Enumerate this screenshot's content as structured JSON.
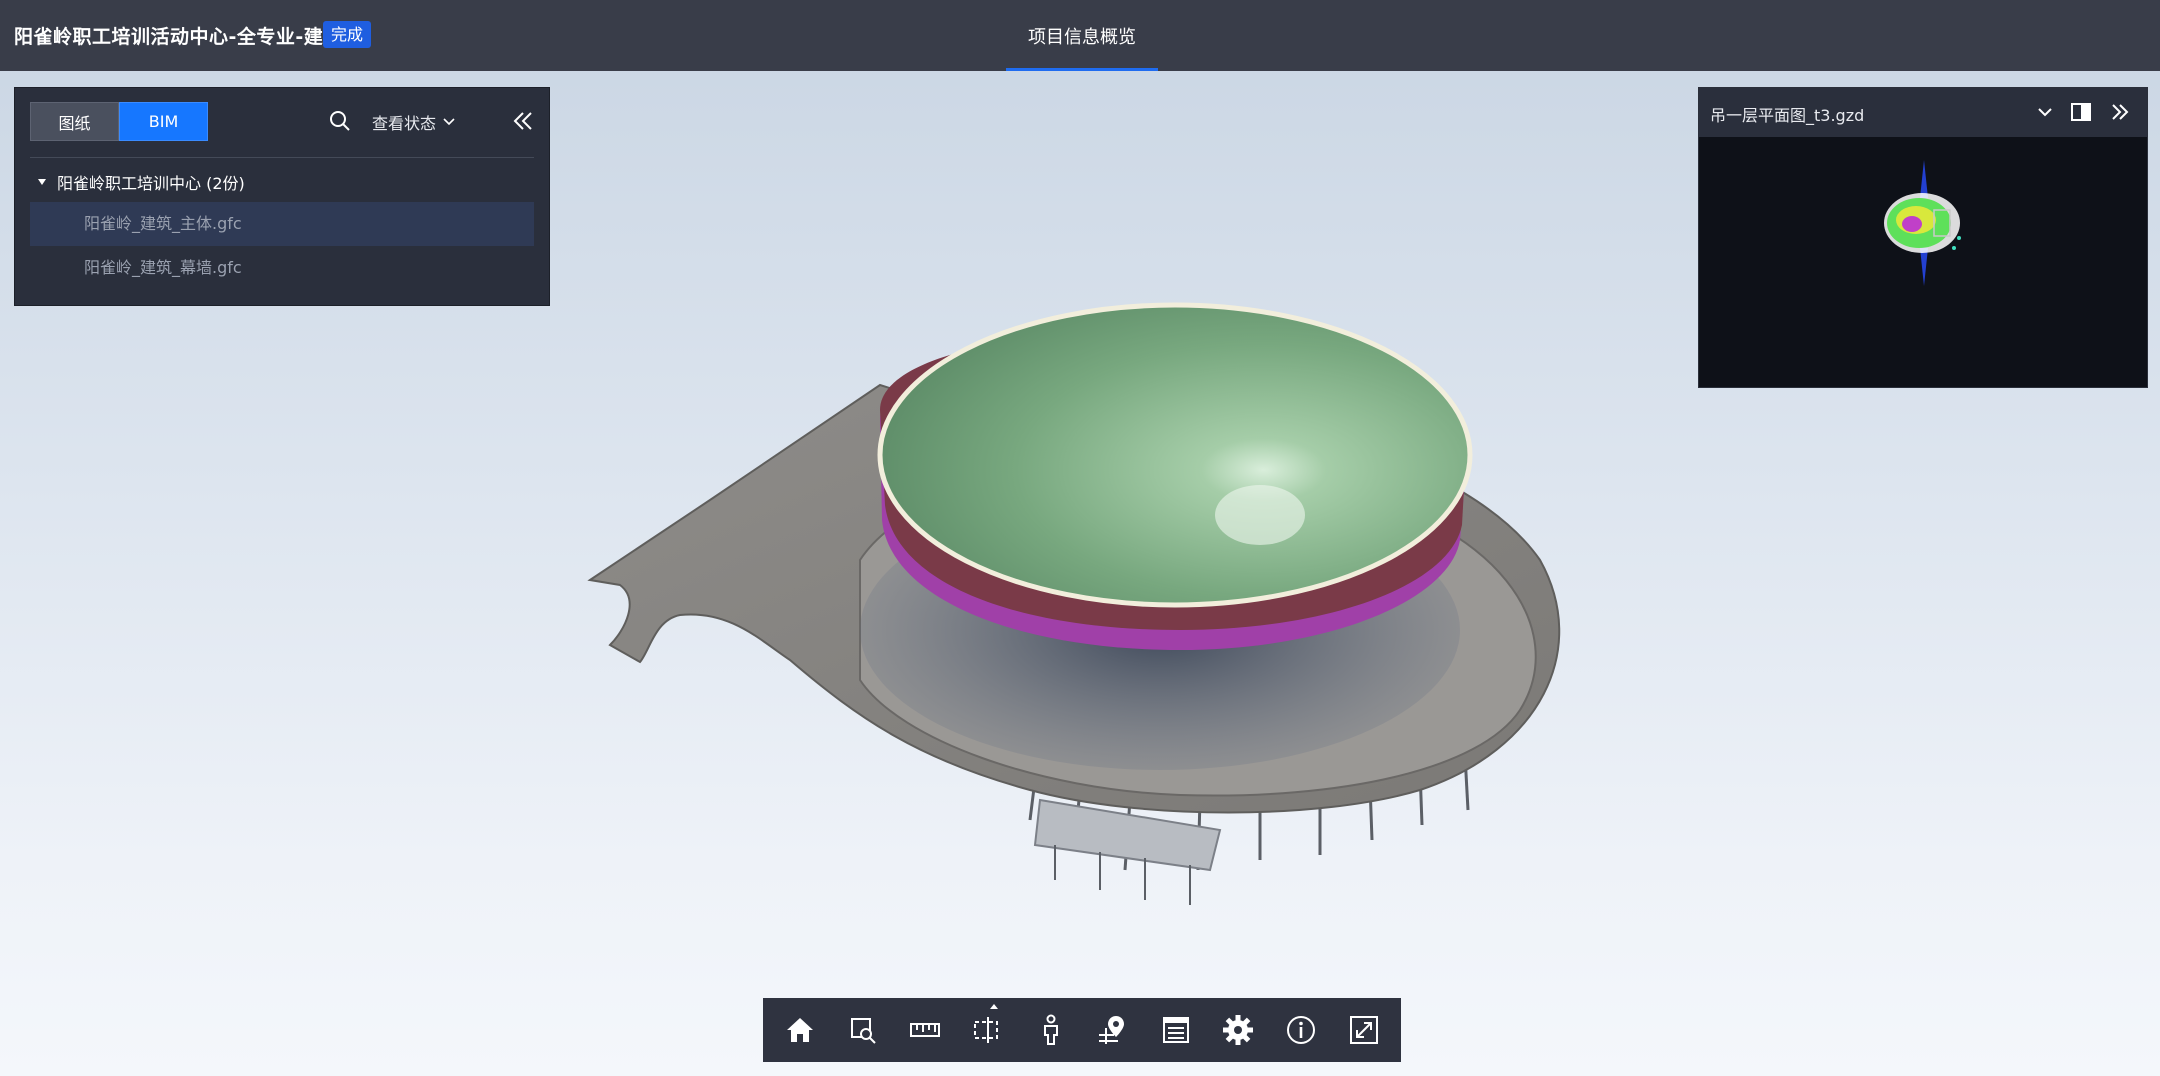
{
  "header": {
    "project_title": "阳雀岭职工培训活动中心-全专业-建筑",
    "status_badge": "完成",
    "center_tab": "项目信息概览"
  },
  "left_panel": {
    "tabs": [
      {
        "label": "图纸",
        "active": false
      },
      {
        "label": "BIM",
        "active": true
      }
    ],
    "status_filter": "查看状态",
    "tree": {
      "root_label": "阳雀岭职工培训中心 (2份)",
      "expanded": true,
      "items": [
        {
          "label": "阳雀岭_建筑_主体.gfc",
          "selected": true
        },
        {
          "label": "阳雀岭_建筑_幕墙.gfc",
          "selected": false
        }
      ]
    }
  },
  "map_panel": {
    "title": "吊一层平面图_t3.gzd"
  },
  "toolbar": {
    "tools": [
      "home-icon",
      "zoom-box-icon",
      "measure-icon",
      "section-box-icon",
      "person-icon",
      "location-pin-icon",
      "list-icon",
      "gear-icon",
      "info-icon",
      "fullscreen-icon"
    ]
  },
  "colors": {
    "topbar": "#393d49",
    "panel": "#2a2f3c",
    "accent": "#1677ff",
    "badge": "#1f5ee0"
  }
}
